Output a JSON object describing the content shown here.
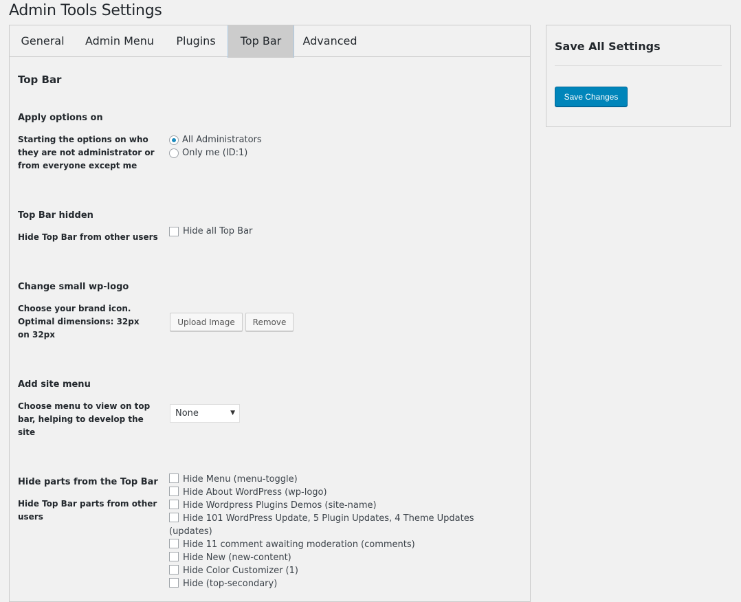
{
  "page": {
    "title": "Admin Tools Settings"
  },
  "tabs": [
    {
      "label": "General",
      "active": false
    },
    {
      "label": "Admin Menu",
      "active": false
    },
    {
      "label": "Plugins",
      "active": false
    },
    {
      "label": "Top Bar",
      "active": true
    },
    {
      "label": "Advanced",
      "active": false
    }
  ],
  "section": {
    "title": "Top Bar"
  },
  "apply_options": {
    "label": "Apply options on",
    "desc": "Starting the options on who they are not administrator or from everyone except me",
    "options": [
      {
        "label": "All Administrators",
        "checked": true
      },
      {
        "label": "Only me (ID:1)",
        "checked": false
      }
    ]
  },
  "top_bar_hidden": {
    "label": "Top Bar hidden",
    "desc": "Hide Top Bar from other users",
    "checkbox_label": "Hide all Top Bar"
  },
  "wp_logo": {
    "label": "Change small wp-logo",
    "desc": "Choose your brand icon. Optimal dimensions: 32px on 32px",
    "upload_label": "Upload Image",
    "remove_label": "Remove"
  },
  "site_menu": {
    "label": "Add site menu",
    "desc": "Choose menu to view on top bar, helping to develop the site",
    "selected": "None"
  },
  "hide_parts": {
    "label": "Hide parts from the Top Bar",
    "desc": "Hide Top Bar parts from other users",
    "items": [
      "Hide Menu (menu-toggle)",
      "Hide About WordPress (wp-logo)",
      "Hide Wordpress Plugins Demos (site-name)",
      "Hide 101 WordPress Update, 5 Plugin Updates, 4 Theme Updates (updates)",
      "Hide 11 comment awaiting moderation (comments)",
      "Hide New (new-content)",
      "Hide Color Customizer (1)",
      "Hide (top-secondary)"
    ]
  },
  "sidebar": {
    "title": "Save All Settings",
    "save_label": "Save Changes"
  },
  "colors": {
    "primary_button": "#0085ba",
    "radio_checked": "#1e8cbe",
    "active_tab_bg": "#cccccc",
    "page_bg": "#f1f1f1"
  }
}
